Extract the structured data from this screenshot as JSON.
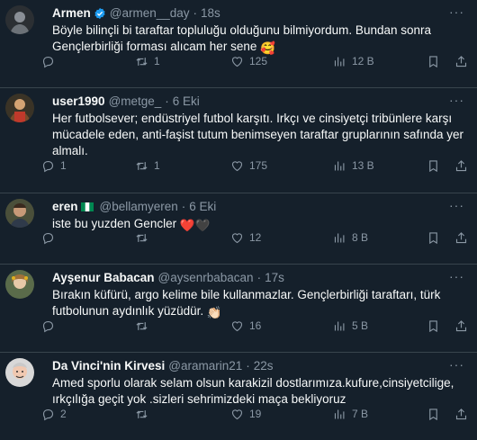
{
  "tweets": [
    {
      "name": "Armen",
      "handle": "@armen__day",
      "dot": "·",
      "time": "18s",
      "text": "Böyle bilinçli bi taraftar topluluğu olduğunu bilmiyordum. Bundan sonra\nGençlerbirliği forması alıcam her sene",
      "emoji": "🥰",
      "replies": "",
      "retweets": "1",
      "likes": "125",
      "views": "12 B",
      "verified": true
    },
    {
      "name": "user1990",
      "handle": "@metge_",
      "dot": "·",
      "time": "6 Eki",
      "text": "Her futbolsever; endüstriyel futbol karşıtı. Irkçı ve cinsiyetçi tribünlere karşı\nmücadele eden, anti-faşist tutum benimseyen taraftar gruplarının safında yer\nalmalı.",
      "emoji": "",
      "replies": "1",
      "retweets": "1",
      "likes": "175",
      "views": "13 B"
    },
    {
      "name": "eren",
      "handle": "@bellamyeren",
      "dot": "·",
      "time": "6 Eki",
      "text": "iste bu yuzden Gencler",
      "emoji": "❤️🖤",
      "replies": "",
      "retweets": "",
      "likes": "12",
      "views": "8 B"
    },
    {
      "name": "Ayşenur Babacan",
      "handle": "@aysenrbabacan",
      "dot": "·",
      "time": "17s",
      "text": "Bırakın küfürü, argo kelime bile kullanmazlar. Gençlerbirliği taraftarı, türk\nfutbolunun aydınlık yüzüdür.",
      "emoji": "👏🏻",
      "replies": "",
      "retweets": "",
      "likes": "16",
      "views": "5 B"
    },
    {
      "name": "Da Vinci'nin Kirvesi",
      "handle": "@aramarin21",
      "dot": "·",
      "time": "22s",
      "text": "Amed sporlu  olarak selam olsun karakizil dostlarımıza.kufure,cinsiyetcilige,\nırkçılığa geçit yok .sizleri sehrimizdeki maça bekliyoruz",
      "emoji": "",
      "replies": "2",
      "retweets": "",
      "likes": "19",
      "views": "7 B"
    }
  ],
  "colors": {
    "background": "#15202b",
    "border": "#38444d",
    "text": "#f7f9f9",
    "muted": "#8b98a5",
    "verified": "#1d9bf0"
  },
  "icons": [
    "reply-icon",
    "retweet-icon",
    "like-icon",
    "views-icon",
    "bookmark-icon",
    "share-icon",
    "more-icon",
    "verified-icon",
    "flag-icon"
  ]
}
